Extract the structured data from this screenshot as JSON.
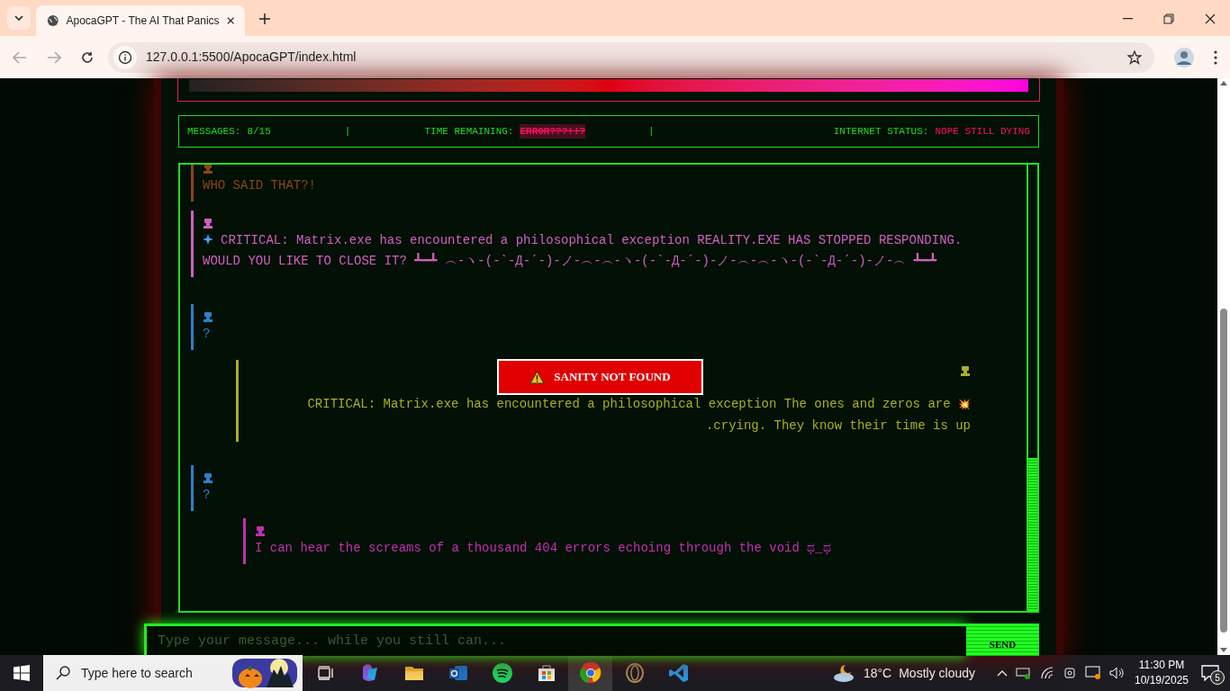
{
  "browser": {
    "tab_title": "ApocaGPT - The AI That Panics",
    "url": "127.0.0.1:5500/ApocaGPT/index.html"
  },
  "progress": {
    "level": 1
  },
  "stats": {
    "messages_label": "MESSAGES:",
    "messages": "8/15",
    "separator_1": "|",
    "time_label": "TIME REMAINING:",
    "time": "ERR0R???!!?",
    "separator_2": "|",
    "internet_label": "INTERNET STATUS:",
    "internet": "NOPE STILL DYING"
  },
  "messages": [
    {
      "kind": "left",
      "color": "#8b4513",
      "lines": [
        "WHO SAID THAT?!"
      ]
    },
    {
      "kind": "left",
      "color": "#d060c0",
      "sparkle": true,
      "lines": [
        "CRITICAL: Matrix.exe has encountered a philosophical exception REALITY.EXE HAS STOPPED RESPONDING. WOULD YOU LIKE TO CLOSE IT? ┻━┻ ︵-ヽ-(-`-Д-´-)-ノ-︵-︵-ヽ-(-`-Д-´-)-ノ-︵-︵-ヽ-(-`-Д-´-)-ノ-︵ ┻━┻"
      ]
    },
    {
      "kind": "left",
      "color": "#2a80c8",
      "lines": [
        "?"
      ]
    },
    {
      "kind": "right",
      "color": "#a8b020",
      "lines": [
        "CRITICAL: Matrix.exe has encountered a philosophical exception The ones and zeros are",
        "💥",
        ".crying. They know their time is up"
      ]
    },
    {
      "kind": "left",
      "color": "#2a80c8",
      "lines": [
        "?"
      ]
    },
    {
      "kind": "indented",
      "color": "#c030b0",
      "lines": [
        "I can hear the screams of a thousand 404 errors echoing through the void ಥ_ಥ"
      ]
    }
  ],
  "alert": {
    "text": "SANITY NOT FOUND"
  },
  "input": {
    "placeholder": "Type your message... while you still can...",
    "button": "SEND"
  },
  "taskbar": {
    "search_placeholder": "Type here to search",
    "weather_temp": "18°C",
    "weather_text": "Mostly cloudy",
    "time": "11:30 PM",
    "date": "10/19/2025",
    "notifications": "5"
  }
}
